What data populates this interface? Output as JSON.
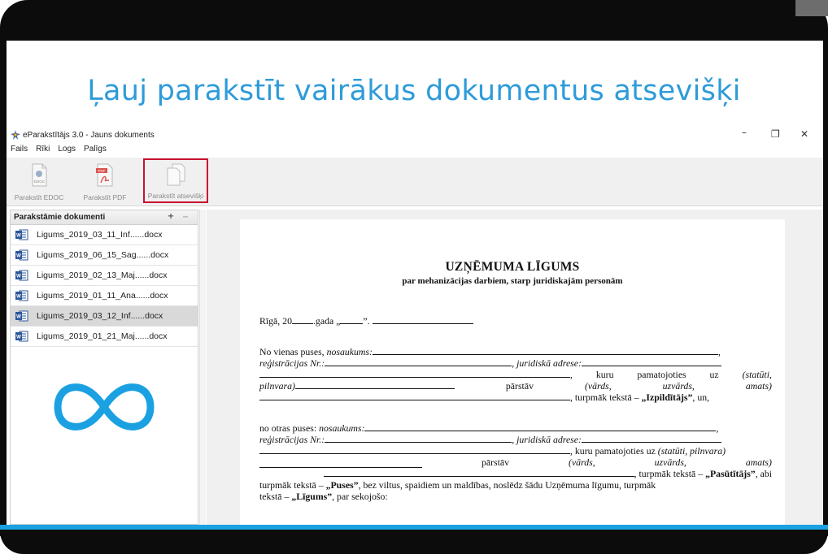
{
  "slide": {
    "title": "Ļauj parakstīt vairākus dokumentus atsevišķi"
  },
  "window": {
    "title": "eParakstītājs 3.0 - Jauns dokuments",
    "controls": {
      "minimize": "–",
      "maximize": "❐",
      "close": "✕"
    }
  },
  "menu": [
    "Fails",
    "Rīki",
    "Logs",
    "Palīgs"
  ],
  "toolbar": {
    "sign_edoc": "Parakstīt EDOC",
    "sign_pdf": "Parakstīt PDF",
    "sign_separately": "Parakstīt atsevišķi"
  },
  "panel": {
    "title": "Parakstāmie dokumenti",
    "add": "+",
    "remove": "–",
    "documents": [
      "Ligums_2019_03_11_Inf......docx",
      "Ligums_2019_06_15_Sag......docx",
      "Ligums_2019_02_13_Maj......docx",
      "Ligums_2019_01_11_Ana......docx",
      "Ligums_2019_03_12_Inf......docx",
      "Ligums_2019_01_21_Maj......docx"
    ],
    "selected_index": 4
  },
  "doc": {
    "title": "UZŅĒMUMA LĪGUMS",
    "subtitle": "par mehanizācijas darbiem, starp juridiskajām personām",
    "place_date": {
      "a": "Rīgā, 20",
      "b": ".gada „",
      "c": "”."
    },
    "p1": {
      "l1a": "No vienas puses, ",
      "l1b": "nosaukums:",
      "l1c": ",",
      "l2a": "reģistrācijas Nr.:",
      "l2b": ", ",
      "l2c": "juridiskā adrese:",
      "l3a": ",",
      "l3b": "kuru",
      "l3c": "pamatojoties",
      "l3d": "uz",
      "l3e": "(statūti,",
      "l4a": "pilnvara)",
      "l4b": "pārstāv",
      "l4c": "(vārds,",
      "l4d": "uzvārds,",
      "l4e": "amats)",
      "l5a": ", turpmāk tekstā – ",
      "l5b": "„Izpildītājs”",
      "l5c": ", un,"
    },
    "p2": {
      "l1a": "no otras puses: ",
      "l1b": "nosaukums:",
      "l1c": ",",
      "l2a": "reģistrācijas Nr.:",
      "l2b": ", ",
      "l2c": "juridiskā adrese:",
      "l3a": ", kuru pamatojoties uz ",
      "l3b": "(statūti, pilnvara)",
      "l4a": "pārstāv",
      "l4b": "(vārds,",
      "l4c": "uzvārds,",
      "l4d": "amats)",
      "l5a": ", turpmāk tekstā – ",
      "l5b": "„Pasūtītājs”",
      "l5c": ", abi",
      "l6a": "turpmāk tekstā – ",
      "l6b": "„Puses”",
      "l6c": ", bez viltus, spaidiem un maldības, noslēdz šādu Uzņēmuma līgumu, turpmāk",
      "l7a": "tekstā – ",
      "l7b": "„Līgums”",
      "l7c": ", par sekojošo:"
    }
  },
  "colors": {
    "accent": "#2e9bd9",
    "highlight": "#c8102e",
    "infinity": "#1ba1e2",
    "word": "#2b579a"
  }
}
